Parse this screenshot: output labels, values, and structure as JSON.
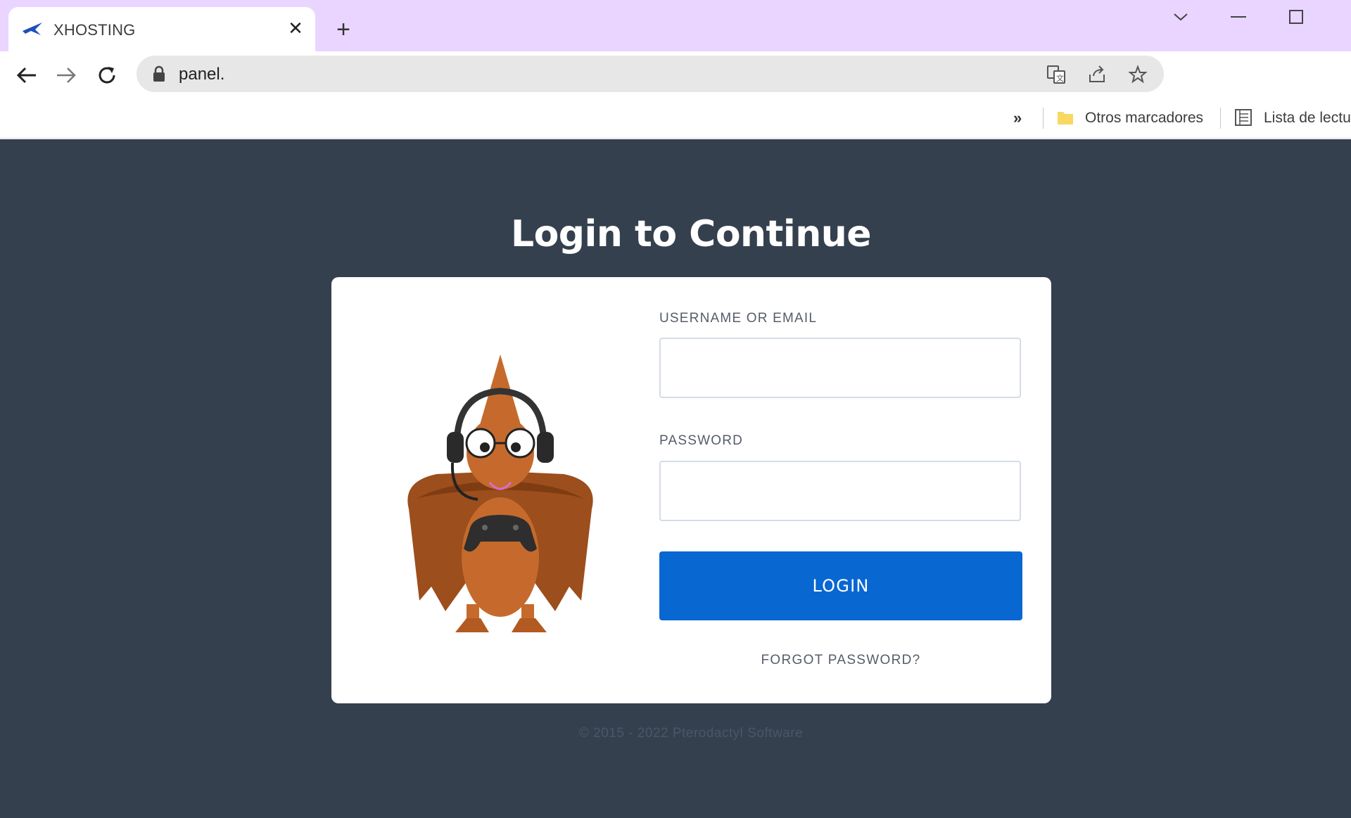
{
  "browser": {
    "tab": {
      "title": "XHOSTING",
      "favicon": "bird-logo-icon"
    },
    "url": "panel.",
    "bookmarks": {
      "other": "Otros marcadores",
      "reading_list": "Lista de lectu"
    },
    "icons": {
      "back": "arrow-left-icon",
      "forward": "arrow-right-icon",
      "reload": "reload-icon",
      "lock": "lock-icon",
      "translate": "translate-icon",
      "share": "share-icon",
      "bookmark": "star-icon"
    }
  },
  "page": {
    "title": "Login to Continue",
    "form": {
      "username_label": "USERNAME OR EMAIL",
      "username_value": "",
      "password_label": "PASSWORD",
      "password_value": "",
      "login_label": "LOGIN",
      "forgot_label": "FORGOT PASSWORD?"
    },
    "footer": "© 2015 - 2022 Pterodactyl Software"
  },
  "colors": {
    "titlebar": "#e9d5ff",
    "page_background": "#35404e",
    "card": "#ffffff",
    "button": "#0967d2",
    "mascot_body": "#c56a2c",
    "mascot_wing": "#9c4e1c"
  }
}
